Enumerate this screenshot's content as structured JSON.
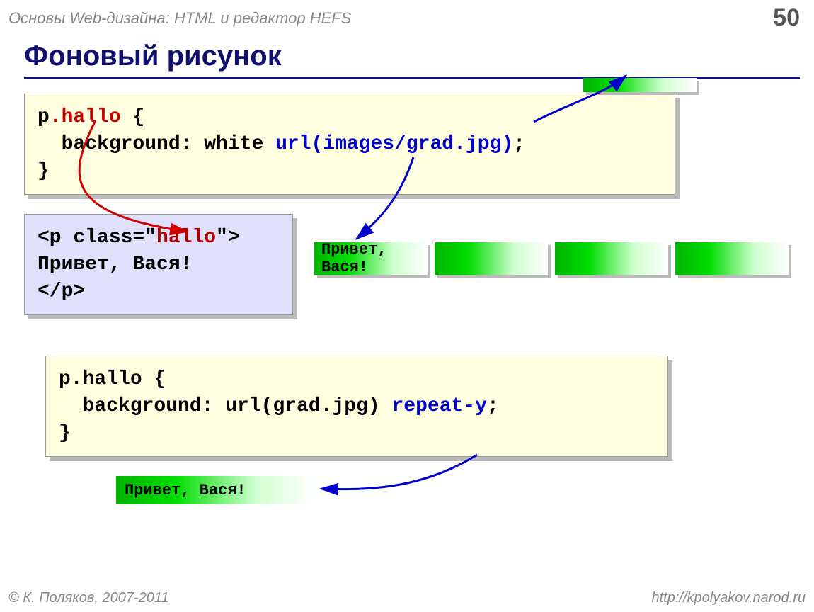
{
  "header": {
    "course_title": "Основы Web-дизайна: HTML и редактор HEFS",
    "page_number": "50"
  },
  "title": "Фоновый рисунок",
  "css_box_1": {
    "line1_a": "p",
    "line1_dot": ".",
    "line1_class": "hallo",
    "line1_open": " {",
    "line2_a": "  background: white ",
    "line2_url": "url(images/grad.jpg)",
    "line2_semi": ";",
    "line3": "}"
  },
  "html_box": {
    "line1_a": "<p class=\"",
    "line1_b": "hallo",
    "line1_c": "\">",
    "line2": "Привет, Вася!",
    "line3": "</p>"
  },
  "sample_text": "Привет, Вася!",
  "css_box_2": {
    "line1": "p.hallo {",
    "line2_a": "  background: url(grad.jpg) ",
    "line2_b": "repeat-y",
    "line2_c": ";",
    "line3": "}"
  },
  "footer": {
    "copyright": "© К. Поляков, 2007-2011",
    "url": "http://kpolyakov.narod.ru"
  }
}
